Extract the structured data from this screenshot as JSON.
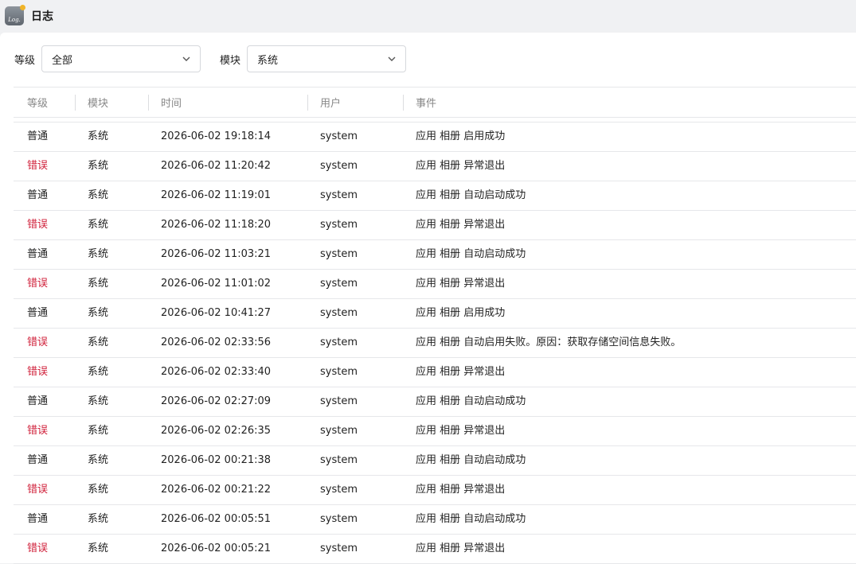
{
  "app": {
    "title": "日志",
    "icon_text": "Log."
  },
  "filters": {
    "level_label": "等级",
    "level_value": "全部",
    "module_label": "模块",
    "module_value": "系统"
  },
  "table": {
    "columns": [
      "等级",
      "模块",
      "时间",
      "用户",
      "事件"
    ],
    "rows": [
      {
        "level": "普通",
        "level_type": "normal",
        "module": "系统",
        "time": "2026-06-02 19:18:14",
        "user": "system",
        "event": "应用 相册 启用成功"
      },
      {
        "level": "错误",
        "level_type": "error",
        "module": "系统",
        "time": "2026-06-02 11:20:42",
        "user": "system",
        "event": "应用 相册 异常退出"
      },
      {
        "level": "普通",
        "level_type": "normal",
        "module": "系统",
        "time": "2026-06-02 11:19:01",
        "user": "system",
        "event": "应用 相册 自动启动成功"
      },
      {
        "level": "错误",
        "level_type": "error",
        "module": "系统",
        "time": "2026-06-02 11:18:20",
        "user": "system",
        "event": "应用 相册 异常退出"
      },
      {
        "level": "普通",
        "level_type": "normal",
        "module": "系统",
        "time": "2026-06-02 11:03:21",
        "user": "system",
        "event": "应用 相册 自动启动成功"
      },
      {
        "level": "错误",
        "level_type": "error",
        "module": "系统",
        "time": "2026-06-02 11:01:02",
        "user": "system",
        "event": "应用 相册 异常退出"
      },
      {
        "level": "普通",
        "level_type": "normal",
        "module": "系统",
        "time": "2026-06-02 10:41:27",
        "user": "system",
        "event": "应用 相册 启用成功"
      },
      {
        "level": "错误",
        "level_type": "error",
        "module": "系统",
        "time": "2026-06-02 02:33:56",
        "user": "system",
        "event": "应用 相册 自动启用失败。原因：获取存储空间信息失败。"
      },
      {
        "level": "错误",
        "level_type": "error",
        "module": "系统",
        "time": "2026-06-02 02:33:40",
        "user": "system",
        "event": "应用 相册 异常退出"
      },
      {
        "level": "普通",
        "level_type": "normal",
        "module": "系统",
        "time": "2026-06-02 02:27:09",
        "user": "system",
        "event": "应用 相册 自动启动成功"
      },
      {
        "level": "错误",
        "level_type": "error",
        "module": "系统",
        "time": "2026-06-02 02:26:35",
        "user": "system",
        "event": "应用 相册 异常退出"
      },
      {
        "level": "普通",
        "level_type": "normal",
        "module": "系统",
        "time": "2026-06-02 00:21:38",
        "user": "system",
        "event": "应用 相册 自动启动成功"
      },
      {
        "level": "错误",
        "level_type": "error",
        "module": "系统",
        "time": "2026-06-02 00:21:22",
        "user": "system",
        "event": "应用 相册 异常退出"
      },
      {
        "level": "普通",
        "level_type": "normal",
        "module": "系统",
        "time": "2026-06-02 00:05:51",
        "user": "system",
        "event": "应用 相册 自动启动成功"
      },
      {
        "level": "错误",
        "level_type": "error",
        "module": "系统",
        "time": "2026-06-02 00:05:21",
        "user": "system",
        "event": "应用 相册 异常退出"
      }
    ]
  },
  "colors": {
    "error": "#d0203a",
    "normal": "#222222"
  }
}
